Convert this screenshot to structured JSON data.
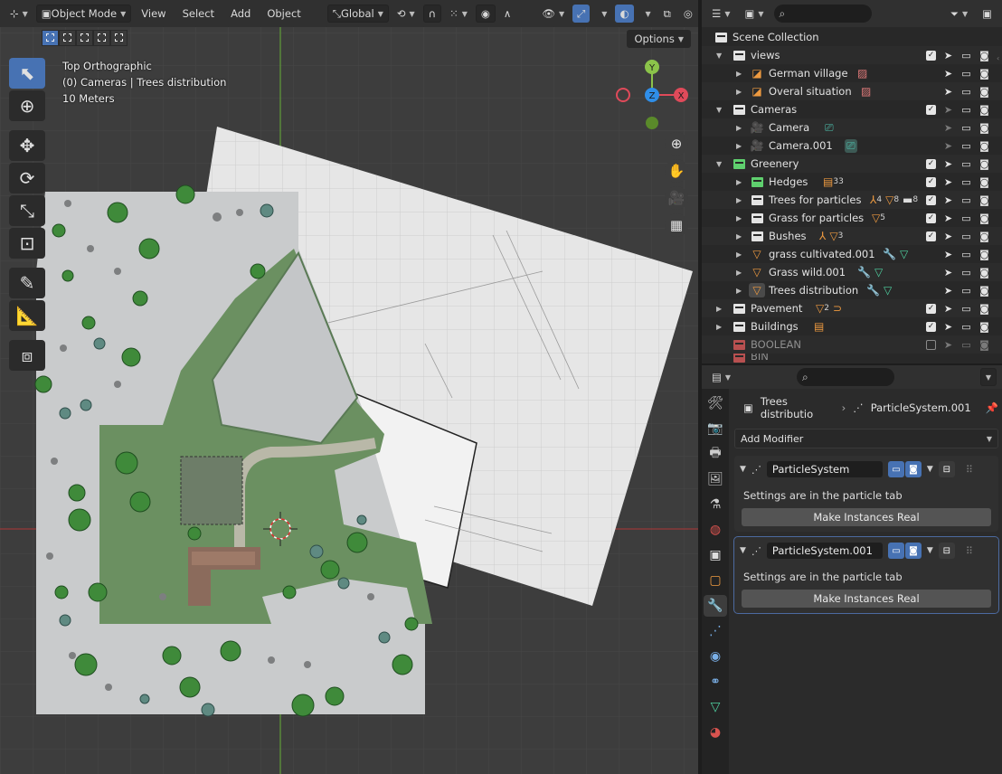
{
  "viewport": {
    "mode": "Object Mode",
    "menus": [
      "View",
      "Select",
      "Add",
      "Object"
    ],
    "transform_orientation": "Global",
    "options_label": "Options",
    "info": {
      "view": "Top Orthographic",
      "context": "(0) Cameras | Trees distribution",
      "scale": "10 Meters"
    },
    "gizmo": {
      "y": "Y",
      "z": "Z",
      "x": "X"
    },
    "colors": {
      "background": "#3d3d3d",
      "ground": "#c9cbcc",
      "grass": "#6b9061",
      "active": "#4772b3"
    }
  },
  "outliner": {
    "rows": [
      {
        "label": "Scene Collection",
        "type": "scene",
        "depth": 0
      },
      {
        "label": "views",
        "type": "collection",
        "depth": 1
      },
      {
        "label": "German village",
        "type": "image",
        "depth": 2
      },
      {
        "label": "Overal situation",
        "type": "image",
        "depth": 2
      },
      {
        "label": "Cameras",
        "type": "collection",
        "depth": 1
      },
      {
        "label": "Camera",
        "type": "camera",
        "depth": 2
      },
      {
        "label": "Camera.001",
        "type": "camera",
        "depth": 2
      },
      {
        "label": "Greenery",
        "type": "collection-green",
        "depth": 1
      },
      {
        "label": "Hedges",
        "type": "collection-green",
        "depth": 2,
        "badge": "33"
      },
      {
        "label": "Trees for particles",
        "type": "collection",
        "depth": 2,
        "badges": [
          "4",
          "8",
          "8"
        ]
      },
      {
        "label": "Grass for particles",
        "type": "collection",
        "depth": 2,
        "badge": "5"
      },
      {
        "label": "Bushes",
        "type": "collection",
        "depth": 2,
        "badge": "3"
      },
      {
        "label": "grass cultivated.001",
        "type": "mesh",
        "depth": 2
      },
      {
        "label": "Grass wild.001",
        "type": "mesh",
        "depth": 2
      },
      {
        "label": "Trees distribution",
        "type": "mesh",
        "depth": 2
      },
      {
        "label": "Pavement",
        "type": "collection",
        "depth": 1,
        "badge": "2"
      },
      {
        "label": "Buildings",
        "type": "collection",
        "depth": 1
      },
      {
        "label": "BOOLEAN",
        "type": "collection-red",
        "depth": 1
      },
      {
        "label": "BIN",
        "type": "collection-red",
        "depth": 1
      }
    ]
  },
  "properties": {
    "breadcrumb": {
      "object": "Trees distributio",
      "modifier": "ParticleSystem.001"
    },
    "add_modifier": "Add Modifier",
    "modifiers": [
      {
        "name": "ParticleSystem",
        "text": "Settings are in the particle tab",
        "button": "Make Instances Real"
      },
      {
        "name": "ParticleSystem.001",
        "text": "Settings are in the particle tab",
        "button": "Make Instances Real"
      }
    ]
  }
}
